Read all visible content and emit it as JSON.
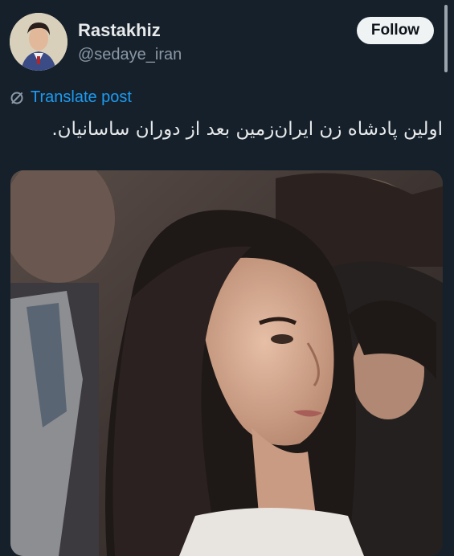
{
  "author": {
    "display_name": "Rastakhiz",
    "handle": "@sedaye_iran",
    "avatar_icon": "profile-portrait"
  },
  "follow_button": {
    "label": "Follow"
  },
  "translate": {
    "label": "Translate post",
    "icon": "translate-icon"
  },
  "post": {
    "text": "اولین پادشاه زن ایران‌زمین بعد از دوران ساسانیان."
  },
  "media": {
    "description": "photo of a woman with long dark hair in a crowd",
    "icon": "photo"
  },
  "colors": {
    "background": "#15202b",
    "text": "#e7e9ea",
    "secondary_text": "#8b98a5",
    "link": "#1d9bf0",
    "button_bg": "#eff3f4"
  }
}
